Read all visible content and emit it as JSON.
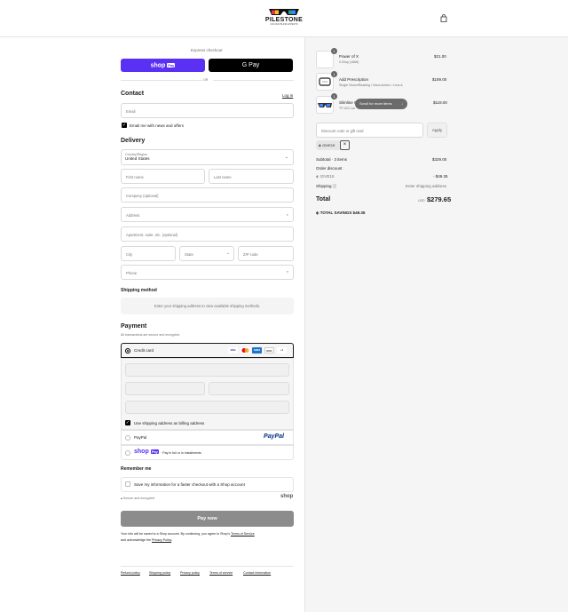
{
  "header": {
    "brand": "PILESTONE",
    "tagline": "COLOUR BLIND EXPERTS"
  },
  "express": {
    "title": "Express checkout",
    "shop_pay": "shop",
    "shop_pay_badge": "Pay",
    "gpay": "G Pay",
    "or": "OR"
  },
  "contact": {
    "title": "Contact",
    "login": "Log in",
    "email_placeholder": "Email",
    "news_label": "Email me with news and offers"
  },
  "delivery": {
    "title": "Delivery",
    "country_label": "Country/Region",
    "country_value": "United States",
    "first_name": "First name",
    "last_name": "Last name",
    "company": "Company (optional)",
    "address": "Address",
    "apartment": "Apartment, suite, etc. (optional)",
    "city": "City",
    "state": "State",
    "zip": "ZIP code",
    "phone": "Phone"
  },
  "shipping_method": {
    "title": "Shipping method",
    "message": "Enter your shipping address to view available shipping methods."
  },
  "payment": {
    "title": "Payment",
    "subtitle": "All transactions are secure and encrypted.",
    "credit_card": "Credit card",
    "cards": [
      "VISA",
      "MC",
      "AMEX",
      "DISC",
      "+4"
    ],
    "billing_label": "Use shipping address as billing address",
    "paypal": "PayPal",
    "paypal_logo": "PayPal",
    "shop_pay_text": "Pay in full or in installments"
  },
  "remember": {
    "title": "Remember me",
    "save_label": "Save my information for a faster checkout with a Shop account",
    "secure": "Secure and encrypted",
    "shop_logo": "shop"
  },
  "pay_now": "Pay now",
  "legal": {
    "line1": "Your info will be saved to a Shop account. By continuing, you agree to Shop's",
    "terms": "Terms of Service",
    "line2": "and acknowledge the",
    "privacy": "Privacy Policy",
    "end": "."
  },
  "footer_links": [
    "Refund policy",
    "Shipping policy",
    "Privacy policy",
    "Terms of service",
    "Contact information"
  ],
  "cart": {
    "items": [
      {
        "qty": "1",
        "name": "Power of X",
        "variant": "0.00up (1866)",
        "price": "$21.00"
      },
      {
        "qty": "1",
        "name": "Add Prescription",
        "variant": "Single Vision/Reading / Nova Acetor / Lens A",
        "price": "$189.00"
      },
      {
        "qty": "1",
        "name": "Slimline C",
        "variant": "TP-022 Lar",
        "price": "$119.00"
      }
    ],
    "scroll_tip": "Scroll for more items",
    "discount_placeholder": "Discount code or gift card",
    "apply": "Apply",
    "code_tag": "GIVE15",
    "subtotal_label": "Subtotal · 3 items",
    "subtotal": "$329.00",
    "order_discount": "Order discount",
    "discount_code": "GIVE15",
    "discount_value": "- $49.35",
    "shipping_label": "Shipping",
    "shipping_value": "Enter shipping address",
    "total_label": "Total",
    "currency": "USD",
    "total": "$279.65",
    "savings_label": "TOTAL SAVINGS",
    "savings": "$49.35"
  },
  "colors": {
    "shop_purple": "#5a31f4",
    "pay_now": "#8c8c8c",
    "paypal_blue": "#003087"
  }
}
